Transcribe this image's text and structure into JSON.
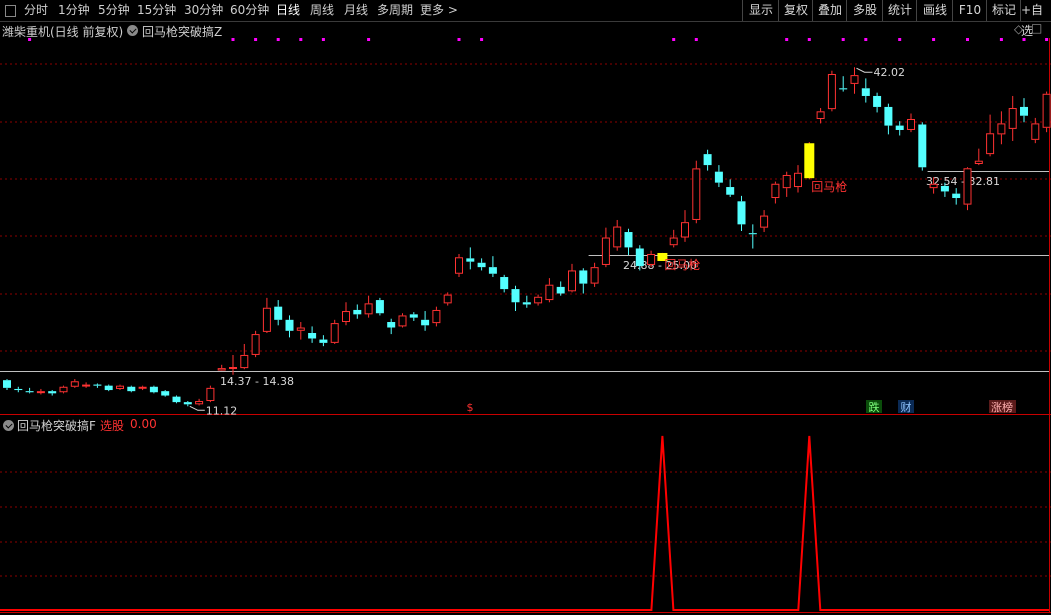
{
  "toolbar": {
    "left_items": [
      "分时",
      "1分钟",
      "5分钟",
      "15分钟",
      "30分钟",
      "60分钟",
      "日线",
      "周线",
      "月线",
      "多周期",
      "更多"
    ],
    "active_item": "日线",
    "more_arrow": ">",
    "right_items": [
      "显示",
      "复权",
      "叠加",
      "多股",
      "统计",
      "画线",
      "F10",
      "标记",
      "+自选"
    ]
  },
  "main_panel": {
    "stock_title": "潍柴重机(日线 前复权)",
    "indicator_name": "回马枪突破搞Z",
    "diamond_icon": "◇",
    "square_icon": "□"
  },
  "sub_panel": {
    "indicator_name": "回马枪突破搞F",
    "output_label": "选股",
    "output_value": "0.00"
  },
  "annotations": {
    "max_price": "42.02",
    "min_price": "11.12",
    "zone_1": "14.37 - 14.38",
    "zone_2": "24.88 - 25.00",
    "zone_3": "32.54 - 32.81",
    "signal_label": "回马枪",
    "dollar_marker": "$",
    "event_badges": [
      "跌",
      "财",
      "涨榜"
    ]
  },
  "colors": {
    "up": "#ff3232",
    "down": "#54ffff",
    "grid": "#8b0000",
    "signal_box": "#ffff00",
    "marker": "#ff00ff",
    "zone_line": "#bfbfbf",
    "indicator_line": "#ff0000"
  },
  "chart_data": {
    "type": "candlestick",
    "series_fields": [
      "open",
      "close",
      "high",
      "low"
    ],
    "price_range": [
      10.6,
      44.5
    ],
    "candles": [
      [
        13.5,
        12.8,
        13.6,
        12.6
      ],
      [
        12.7,
        12.6,
        12.9,
        12.4
      ],
      [
        12.5,
        12.4,
        12.8,
        12.3
      ],
      [
        12.4,
        12.5,
        12.7,
        12.2
      ],
      [
        12.5,
        12.3,
        12.6,
        12.1
      ],
      [
        12.4,
        12.9,
        13.0,
        12.3
      ],
      [
        12.9,
        13.4,
        13.6,
        12.8
      ],
      [
        13.0,
        13.1,
        13.3,
        12.8
      ],
      [
        13.1,
        13.0,
        13.2,
        12.8
      ],
      [
        13.0,
        12.6,
        13.1,
        12.5
      ],
      [
        12.7,
        13.0,
        13.1,
        12.6
      ],
      [
        12.9,
        12.5,
        13.0,
        12.4
      ],
      [
        12.8,
        12.9,
        13.0,
        12.6
      ],
      [
        12.9,
        12.4,
        13.0,
        12.3
      ],
      [
        12.5,
        12.1,
        12.6,
        12.0
      ],
      [
        12.0,
        11.5,
        12.1,
        11.4
      ],
      [
        11.5,
        11.3,
        11.6,
        11.12
      ],
      [
        11.3,
        11.6,
        11.8,
        11.2
      ],
      [
        11.6,
        12.8,
        13.0,
        11.5
      ],
      [
        14.38,
        14.6,
        14.9,
        14.37
      ],
      [
        14.6,
        14.7,
        15.8,
        14.0
      ],
      [
        14.6,
        15.8,
        16.8,
        14.5
      ],
      [
        15.8,
        17.7,
        18.0,
        15.6
      ],
      [
        17.9,
        20.1,
        21.0,
        17.8
      ],
      [
        20.2,
        19.0,
        20.8,
        18.5
      ],
      [
        19.0,
        18.0,
        19.4,
        17.4
      ],
      [
        18.0,
        18.3,
        18.8,
        17.2
      ],
      [
        17.8,
        17.3,
        18.4,
        16.9
      ],
      [
        17.2,
        16.9,
        17.6,
        16.6
      ],
      [
        16.9,
        18.7,
        19.0,
        16.8
      ],
      [
        18.8,
        19.8,
        20.6,
        18.5
      ],
      [
        19.9,
        19.5,
        20.4,
        19.1
      ],
      [
        19.5,
        20.5,
        21.2,
        19.2
      ],
      [
        20.8,
        19.6,
        21.0,
        19.4
      ],
      [
        18.8,
        18.3,
        19.1,
        17.7
      ],
      [
        18.4,
        19.4,
        19.6,
        18.3
      ],
      [
        19.5,
        19.2,
        19.7,
        18.9
      ],
      [
        19.0,
        18.5,
        19.8,
        18.0
      ],
      [
        18.7,
        19.9,
        20.2,
        18.4
      ],
      [
        20.5,
        21.3,
        21.5,
        20.3
      ],
      [
        23.2,
        24.7,
        25.0,
        22.9
      ],
      [
        24.6,
        24.3,
        25.6,
        23.6
      ],
      [
        24.2,
        23.8,
        24.6,
        23.5
      ],
      [
        23.8,
        23.2,
        24.8,
        22.9
      ],
      [
        22.9,
        21.8,
        23.1,
        21.5
      ],
      [
        21.8,
        20.6,
        22.1,
        19.8
      ],
      [
        20.6,
        20.4,
        21.2,
        20.1
      ],
      [
        20.5,
        21.1,
        21.3,
        20.3
      ],
      [
        20.8,
        22.2,
        22.8,
        20.6
      ],
      [
        22.0,
        21.4,
        22.5,
        21.2
      ],
      [
        21.6,
        23.5,
        24.1,
        21.5
      ],
      [
        23.5,
        22.3,
        23.7,
        21.4
      ],
      [
        22.3,
        23.8,
        24.2,
        22.0
      ],
      [
        24.0,
        26.5,
        27.4,
        23.8
      ],
      [
        25.6,
        27.5,
        28.1,
        25.3
      ],
      [
        27.0,
        25.6,
        27.3,
        24.9
      ],
      [
        25.5,
        23.9,
        25.8,
        23.5
      ],
      [
        24.0,
        25.0,
        25.3,
        23.8
      ],
      [
        24.9,
        25.0,
        25.1,
        24.88
      ],
      [
        25.8,
        26.5,
        27.2,
        25.6
      ],
      [
        26.5,
        27.9,
        29.0,
        26.1
      ],
      [
        28.1,
        32.8,
        33.5,
        27.8
      ],
      [
        34.1,
        33.1,
        34.5,
        32.6
      ],
      [
        32.5,
        31.5,
        33.1,
        31.1
      ],
      [
        31.1,
        30.4,
        31.8,
        30.2
      ],
      [
        29.8,
        27.7,
        30.3,
        27.1
      ],
      [
        26.9,
        26.8,
        27.7,
        25.5
      ],
      [
        27.4,
        28.5,
        29.0,
        27.0
      ],
      [
        30.1,
        31.4,
        31.6,
        29.6
      ],
      [
        31.0,
        32.2,
        32.5,
        30.2
      ],
      [
        31.1,
        32.4,
        33.1,
        30.6
      ],
      [
        32.0,
        35.0,
        35.2,
        31.8
      ],
      [
        37.3,
        38.0,
        38.3,
        36.9
      ],
      [
        38.2,
        41.4,
        41.7,
        38.0
      ],
      [
        40.1,
        40.0,
        41.2,
        39.8
      ],
      [
        40.5,
        41.3,
        42.02,
        39.6
      ],
      [
        40.1,
        39.4,
        41.0,
        38.8
      ],
      [
        39.4,
        38.4,
        39.7,
        37.9
      ],
      [
        38.4,
        36.7,
        38.7,
        35.9
      ],
      [
        36.7,
        36.3,
        37.1,
        35.8
      ],
      [
        36.3,
        37.3,
        37.8,
        36.1
      ],
      [
        36.8,
        32.9,
        37.0,
        32.6
      ],
      [
        31.0,
        31.4,
        32.0,
        30.5
      ],
      [
        31.2,
        30.7,
        31.5,
        30.2
      ],
      [
        30.5,
        30.1,
        31.0,
        29.5
      ],
      [
        29.5,
        32.81,
        32.9,
        29.0
      ],
      [
        33.2,
        33.5,
        34.6,
        33.1
      ],
      [
        34.1,
        36.0,
        37.7,
        33.9
      ],
      [
        35.9,
        36.9,
        38.0,
        35.0
      ],
      [
        36.4,
        38.3,
        39.4,
        35.3
      ],
      [
        38.4,
        37.6,
        39.2,
        37.0
      ],
      [
        35.4,
        36.9,
        37.4,
        35.1
      ],
      [
        36.5,
        39.6,
        39.8,
        36.1
      ],
      [
        39.2,
        38.9,
        40.4,
        38.5
      ]
    ],
    "signal_candles": [
      58,
      71
    ],
    "signal_labels": [
      "回马枪",
      "回马枪"
    ],
    "zones": [
      {
        "label": "14.37 - 14.38",
        "price": 14.37
      },
      {
        "label": "24.88 - 25.00",
        "price": 24.88
      },
      {
        "label": "32.54 - 32.81",
        "price": 32.54
      }
    ],
    "max_point": {
      "index": 75,
      "price": 42.02
    },
    "min_point": {
      "index": 16,
      "price": 11.12
    },
    "marker_candles": [
      2,
      20,
      22,
      24,
      26,
      28,
      32,
      40,
      42,
      59,
      61,
      69,
      71,
      74,
      76,
      79,
      82,
      85,
      88,
      90,
      92
    ],
    "sub_indicator": {
      "name": "回马枪突破搞F",
      "values_index_is_candle": true,
      "spikes_at": [
        58,
        71
      ],
      "base": 0,
      "peak": 1
    }
  }
}
